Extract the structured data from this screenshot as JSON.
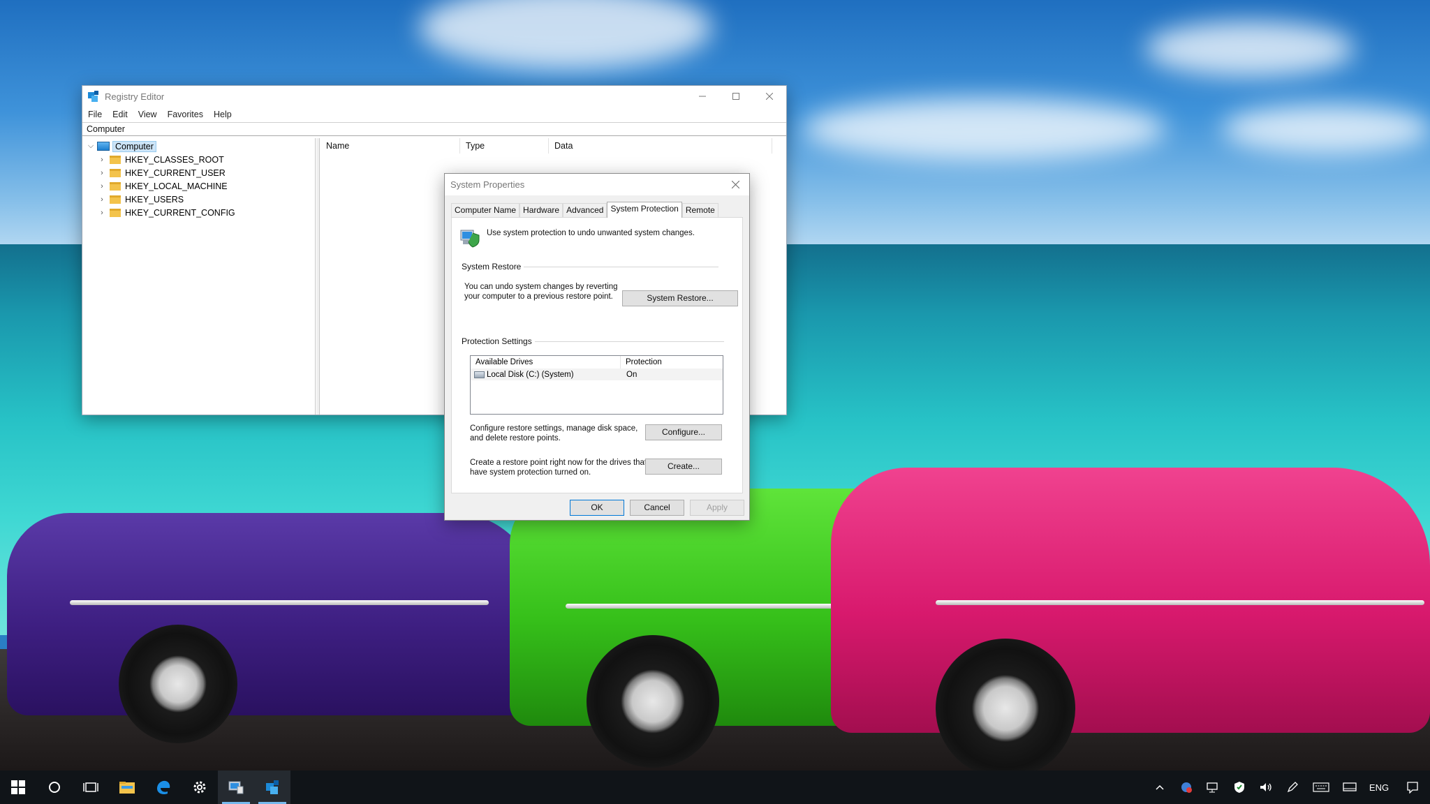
{
  "regedit": {
    "title": "Registry Editor",
    "menu": [
      "File",
      "Edit",
      "View",
      "Favorites",
      "Help"
    ],
    "address": "Computer",
    "tree": {
      "root": "Computer",
      "hives": [
        "HKEY_CLASSES_ROOT",
        "HKEY_CURRENT_USER",
        "HKEY_LOCAL_MACHINE",
        "HKEY_USERS",
        "HKEY_CURRENT_CONFIG"
      ]
    },
    "columns": [
      "Name",
      "Type",
      "Data"
    ]
  },
  "sysprops": {
    "title": "System Properties",
    "tabs": [
      "Computer Name",
      "Hardware",
      "Advanced",
      "System Protection",
      "Remote"
    ],
    "active_tab": "System Protection",
    "intro": "Use system protection to undo unwanted system changes.",
    "restore": {
      "group": "System Restore",
      "desc_line1": "You can undo system changes by reverting",
      "desc_line2": "your computer to a previous restore point.",
      "button": "System Restore..."
    },
    "protection": {
      "group": "Protection Settings",
      "col_drives": "Available Drives",
      "col_protection": "Protection",
      "drives": [
        {
          "name": "Local Disk (C:) (System)",
          "status": "On"
        }
      ],
      "configure_line1": "Configure restore settings, manage disk space,",
      "configure_line2": "and delete restore points.",
      "configure_button": "Configure...",
      "create_line1": "Create a restore point right now for the drives that",
      "create_line2": "have system protection turned on.",
      "create_button": "Create..."
    },
    "buttons": {
      "ok": "OK",
      "cancel": "Cancel",
      "apply": "Apply"
    }
  },
  "taskbar": {
    "language": "ENG"
  },
  "colors": {
    "taskbar": "#101418",
    "accent": "#0078d7",
    "selection": "#cce4f7"
  }
}
